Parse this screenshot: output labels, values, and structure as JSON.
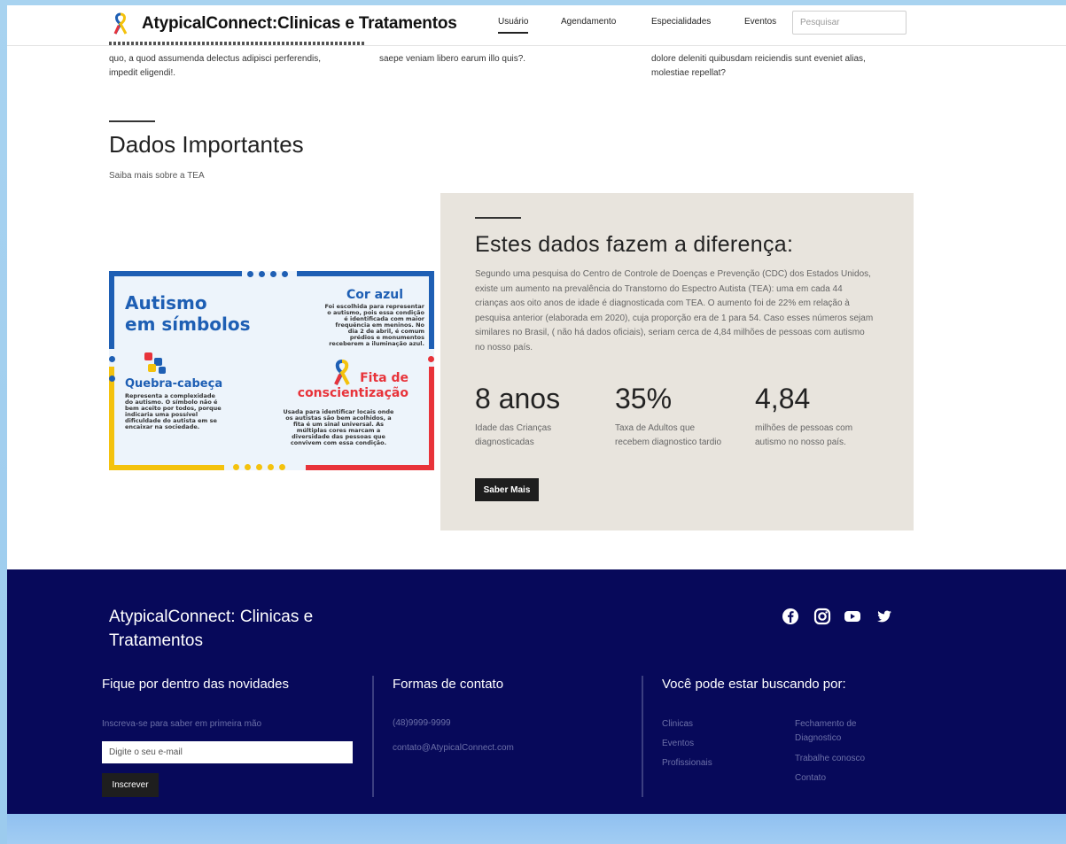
{
  "header": {
    "brand": "AtypicalConnect:Clinicas e Tratamentos",
    "nav": [
      "Usuário",
      "Agendamento",
      "Especialidades",
      "Eventos"
    ],
    "search_placeholder": "Pesquisar"
  },
  "top_columns": [
    {
      "lines": [
        "quo, a quod assumenda delectus adipisci perferendis,",
        "impedit eligendi!."
      ]
    },
    {
      "lines": [
        "saepe veniam libero earum illo quis?."
      ]
    },
    {
      "lines": [
        "dolore deleniti quibusdam reiciendis sunt eveniet alias,",
        "molestiae repellat?"
      ]
    }
  ],
  "section": {
    "title": "Dados Importantes",
    "subtitle": "Saiba mais sobre a TEA"
  },
  "infographic": {
    "title_line1": "Autismo",
    "title_line2": "em símbolos",
    "cor_azul": {
      "title": "Cor azul",
      "lines": [
        "Foi escolhida para representar",
        "o autismo, pois essa condição",
        "é identificada com maior",
        "frequência em meninos. No",
        "dia 2 de abril, é comum",
        "prédios e monumentos",
        "receberem a iluminação azul."
      ]
    },
    "quebra_cabeca": {
      "title": "Quebra-cabeça",
      "lines": [
        "Representa a complexidade",
        "do autismo. O símbolo não é",
        "bem aceito por todos, porque",
        "indicaria uma possível",
        "dificuldade do autista em se",
        "encaixar na sociedade."
      ]
    },
    "fita": {
      "title_line1": "Fita de",
      "title_line2": "conscientização",
      "lines": [
        "Usada para identificar locais onde",
        "os autistas são bem acolhidos, a",
        "fita é um sinal universal. As",
        "múltiplas cores marcam a",
        "diversidade das pessoas que",
        "convivem com essa condição."
      ]
    }
  },
  "stats_panel": {
    "title": "Estes dados fazem a diferença:",
    "paragraph": "Segundo uma pesquisa do Centro de Controle de Doenças e Prevenção (CDC) dos Estados Unidos, existe um aumento na prevalência do Transtorno do Espectro Autista (TEA): uma em cada 44 crianças aos oito anos de idade é diagnosticada com TEA. O aumento foi de 22% em relação à pesquisa anterior (elaborada em 2020), cuja proporção era de 1 para 54. Caso esses números sejam similares no Brasil, ( não há dados oficiais), seriam cerca de 4,84 milhões de pessoas com autismo no nosso país.",
    "stats": [
      {
        "value": "8 anos",
        "label_line1": "Idade das Crianças",
        "label_line2": "diagnosticadas"
      },
      {
        "value": "35%",
        "label_line1": "Taxa de Adultos que",
        "label_line2": "recebem diagnostico tardio"
      },
      {
        "value": "4,84",
        "label_line1": "milhões de pessoas com",
        "label_line2": "autismo no nosso país."
      }
    ],
    "button": "Saber Mais"
  },
  "footer": {
    "brand_line1": "AtypicalConnect: Clinicas e",
    "brand_line2": "Tratamentos",
    "social_icons": [
      "facebook-icon",
      "instagram-icon",
      "youtube-icon",
      "twitter-icon"
    ],
    "newsletter": {
      "heading": "Fique por dentro das novidades",
      "text": "Inscreva-se para saber em primeira mão",
      "email_placeholder": "Digite o seu e-mail",
      "button": "Inscrever"
    },
    "contact": {
      "heading": "Formas de contato",
      "phone": "(48)9999-9999",
      "email": "contato@AtypicalConnect.com"
    },
    "links": {
      "heading": "Você pode estar buscando por:",
      "col1": [
        "Clinicas",
        "Eventos",
        "Profissionais"
      ],
      "col2_line1": "Fechamento de",
      "col2_line2": "Diagnostico",
      "col2_rest": [
        "Trabalhe conosco",
        "Contato"
      ]
    }
  },
  "colors": {
    "footer_bg": "#07095a",
    "panel_bg": "#e8e4dd",
    "info_blue": "#1e5fb4",
    "info_red": "#e8333a",
    "info_yellow": "#f4c20d"
  }
}
